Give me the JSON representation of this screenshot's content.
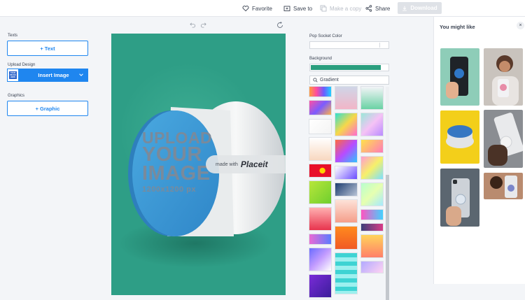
{
  "toolbar": {
    "favorite": "Favorite",
    "save_to": "Save to",
    "make_copy": "Make a copy",
    "share": "Share",
    "download": "Download"
  },
  "left_panel": {
    "texts_label": "Texts",
    "add_text": "+ Text",
    "upload_label": "Upload Design",
    "upload_thumb_text": "YOUR IMAGE HERE",
    "insert_image": "Insert Image",
    "graphics_label": "Graphics",
    "add_graphic": "+ Graphic"
  },
  "canvas": {
    "placeholder_lines": [
      "UPLOAD",
      "YOUR",
      "IMAGE"
    ],
    "placeholder_size": "1200x1200 px",
    "watermark_prefix": "made with",
    "watermark_brand": "Placeit",
    "background_color": "#2e9e86"
  },
  "settings": {
    "pop_socket_color_label": "Pop Socket Color",
    "background_label": "Background",
    "background_value": "#2a9e7e",
    "search_value": "Gradient"
  },
  "side_panel": {
    "title": "You might like",
    "close": "×"
  },
  "colors": {
    "accent": "#1f86ef",
    "canvas_green": "#2e9e86",
    "socket_blue": "#3aa0d8"
  }
}
